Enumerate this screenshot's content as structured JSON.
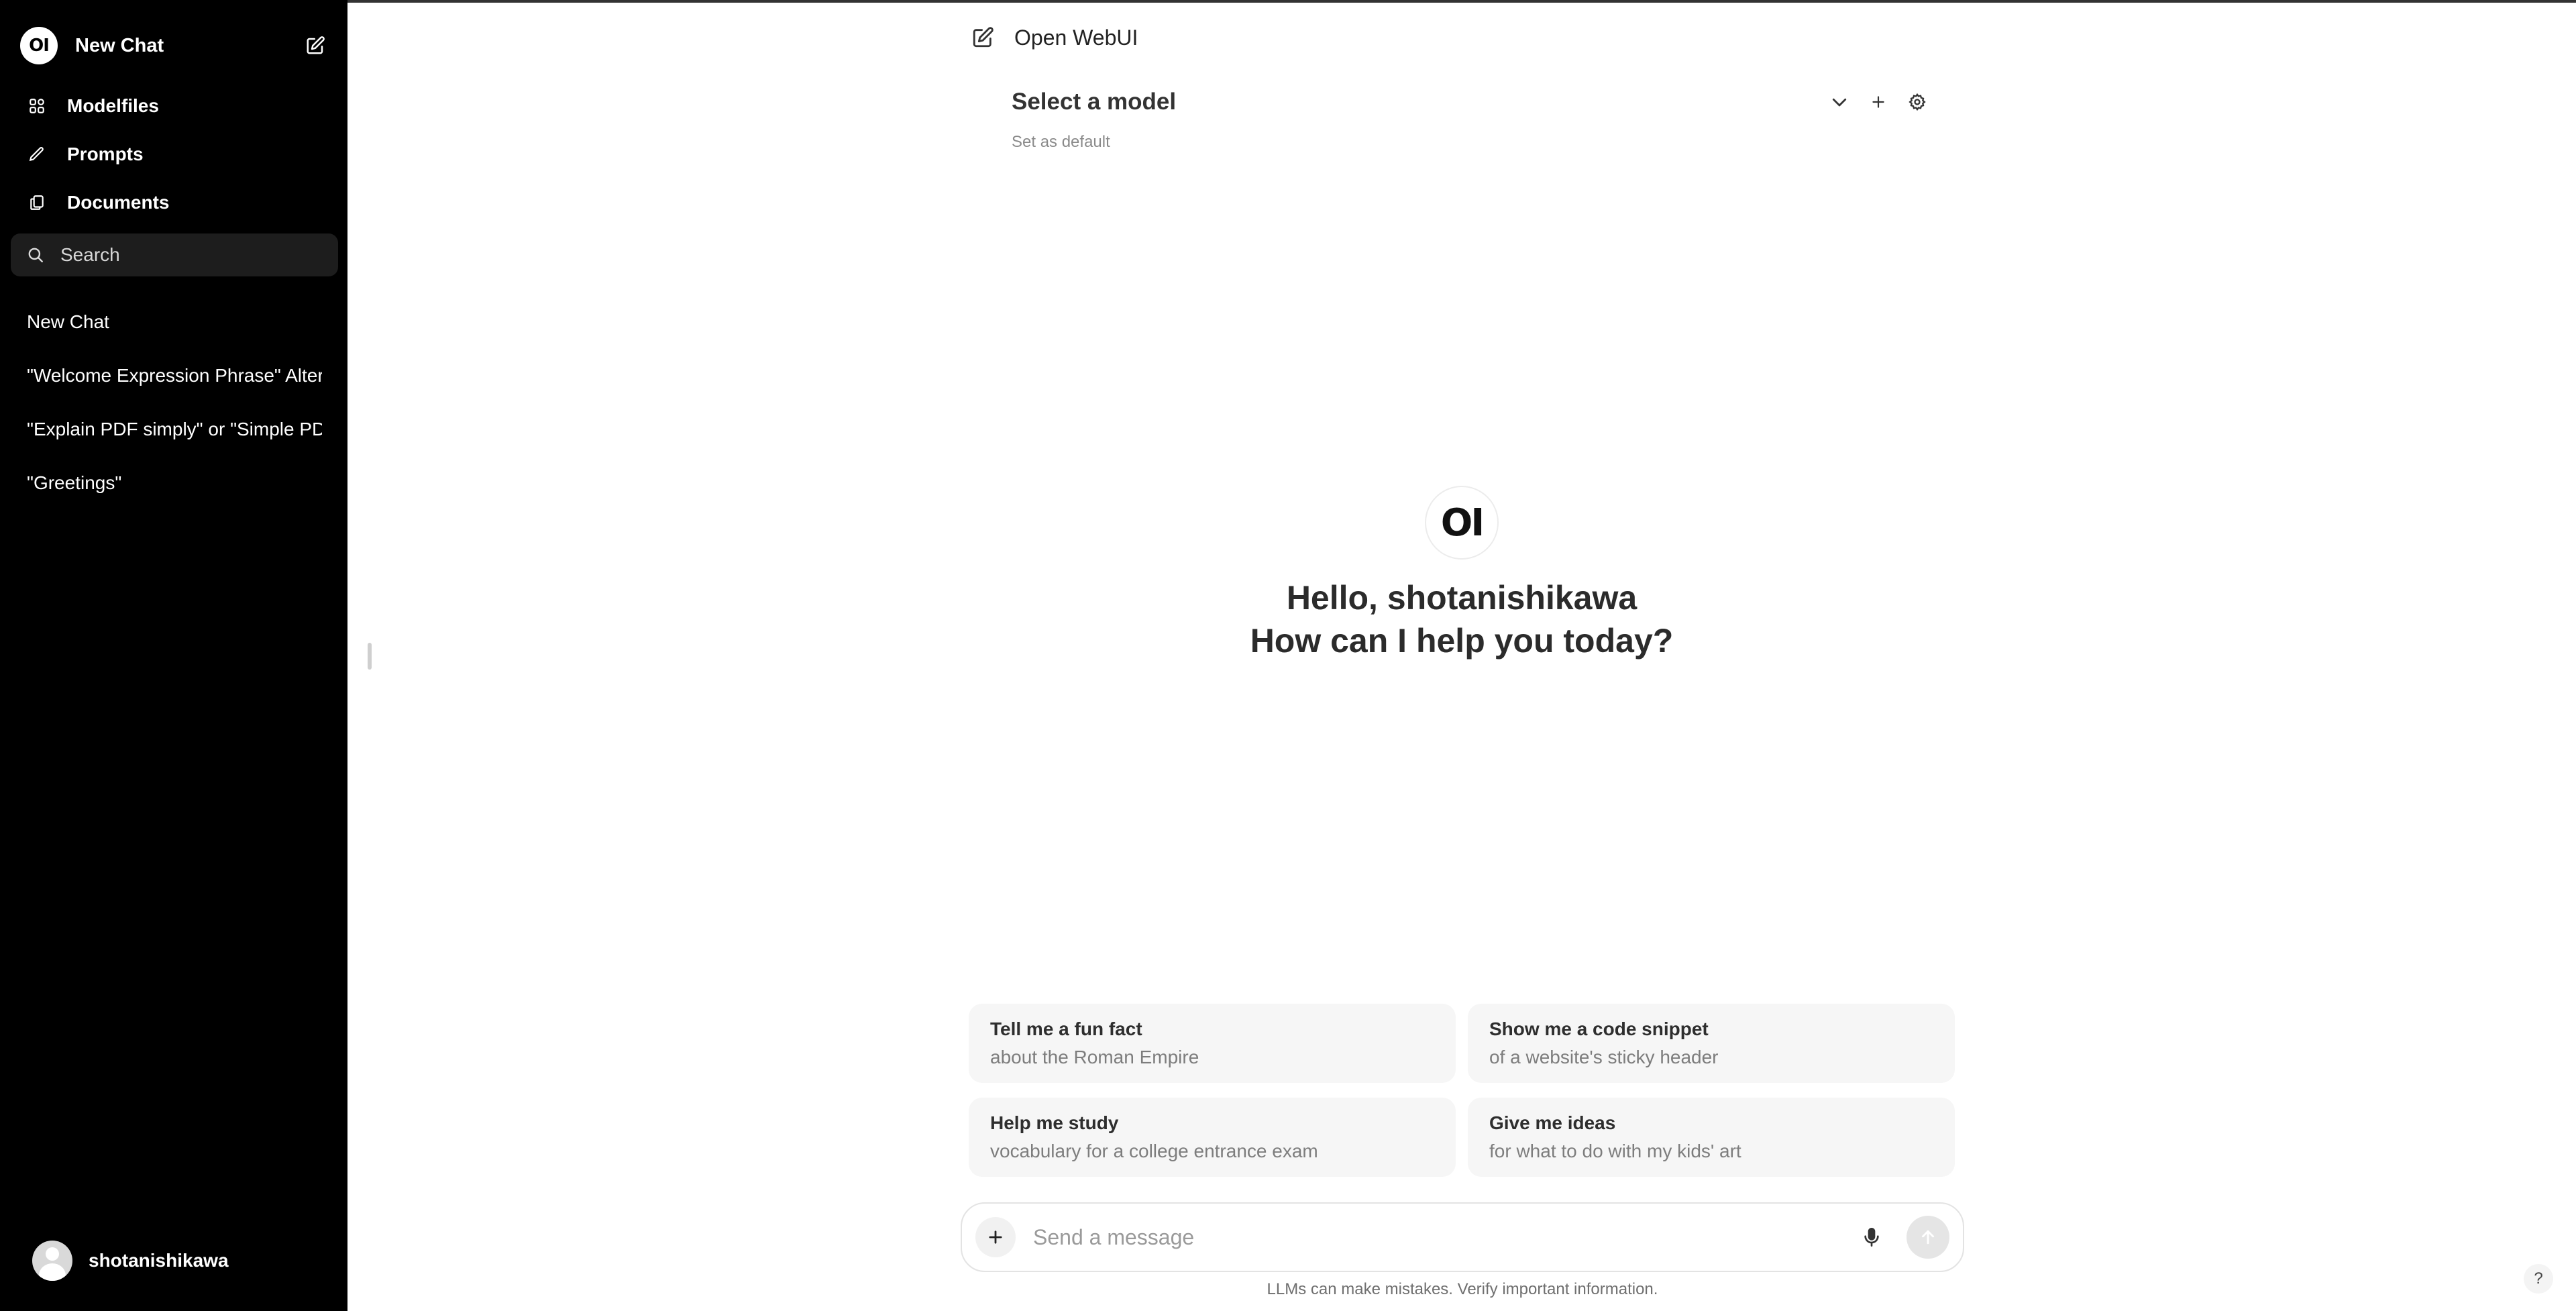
{
  "sidebar": {
    "logo_text": "OI",
    "new_chat_label": "New Chat",
    "nav": [
      {
        "label": "Modelfiles",
        "icon": "modelfiles-icon"
      },
      {
        "label": "Prompts",
        "icon": "pencil-icon"
      },
      {
        "label": "Documents",
        "icon": "documents-icon"
      }
    ],
    "search": {
      "placeholder": "Search",
      "value": ""
    },
    "chats": [
      "New Chat",
      "\"Welcome Expression Phrase\" Alternatives",
      "\"Explain PDF simply\" or \"Simple PDF Explanation\"",
      "\"Greetings\""
    ],
    "user": {
      "name": "shotanishikawa"
    }
  },
  "main": {
    "title": "Open WebUI",
    "model_selector": {
      "label": "Select a model",
      "set_default": "Set as default"
    },
    "hero": {
      "logo_text": "OI",
      "greeting": "Hello, shotanishikawa",
      "prompt": "How can I help you today?"
    },
    "suggestions": [
      {
        "title": "Tell me a fun fact",
        "subtitle": "about the Roman Empire"
      },
      {
        "title": "Show me a code snippet",
        "subtitle": "of a website's sticky header"
      },
      {
        "title": "Help me study",
        "subtitle": "vocabulary for a college entrance exam"
      },
      {
        "title": "Give me ideas",
        "subtitle": "for what to do with my kids' art"
      }
    ],
    "composer": {
      "placeholder": "Send a message",
      "value": ""
    },
    "disclaimer": "LLMs can make mistakes. Verify important information.",
    "help_label": "?"
  },
  "colors": {
    "sidebar_bg": "#000000",
    "search_bg": "#1d1d1d",
    "card_bg": "#f6f6f6",
    "text_primary": "#2b2b2b",
    "text_muted": "#7d7d7d"
  }
}
